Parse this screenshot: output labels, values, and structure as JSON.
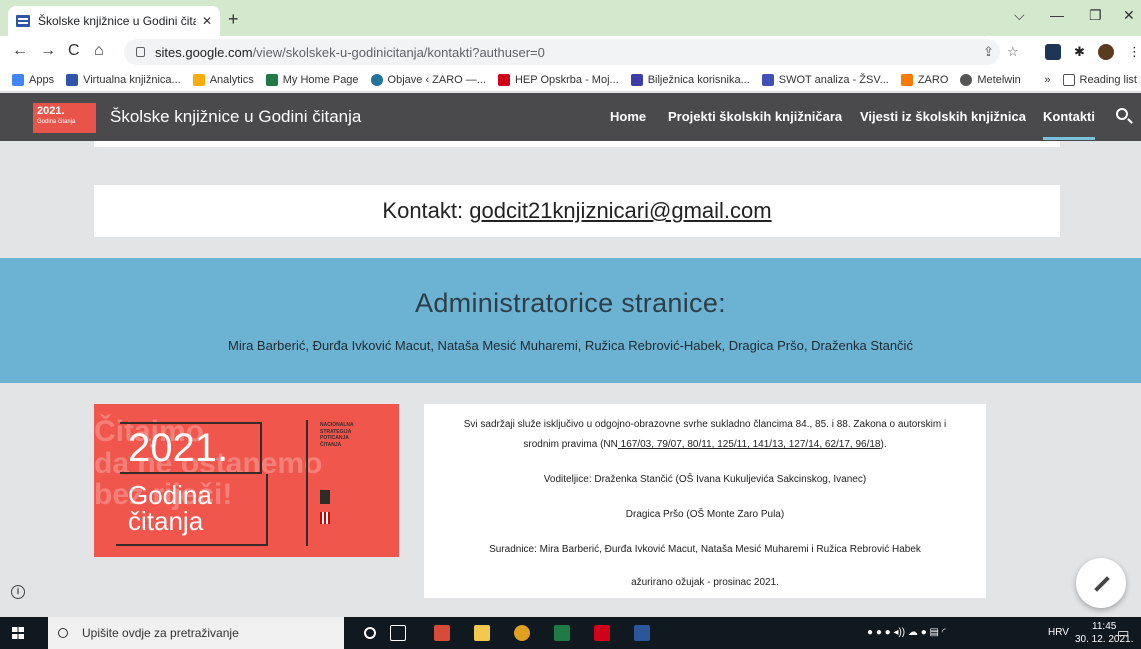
{
  "browser": {
    "tab_title": "Školske knjižnice u Godini čitanja",
    "url_host": "sites.google.com",
    "url_path": "/view/skolskek-u-godinicitanja/kontakti?authuser=0",
    "new_tab": "+",
    "tab_close": "✕"
  },
  "bookmarks": {
    "items": [
      "Apps",
      "Virtualna knjižnica...",
      "Analytics",
      "My Home Page",
      "Objave ‹ ZARO —...",
      "HEP Opskrba - Moj...",
      "Bilježnica korisnika...",
      "SWOT analiza - ŽSV...",
      "ZARO",
      "Metelwin"
    ],
    "overflow": "»",
    "reading_list": "Reading list"
  },
  "site": {
    "logo_year": "2021.",
    "logo_sub": "Godina čitanja",
    "title": "Školske knjižnice u Godini čitanja",
    "nav": [
      "Home",
      "Projekti školskih knjižničara",
      "Vijesti iz školskih knjižnica",
      "Kontakti"
    ],
    "active_nav": "Kontakti"
  },
  "contact": {
    "prefix": "Kontakt: ",
    "email": "godcit21knjiznicari@gmail.com"
  },
  "admins": {
    "heading": "Administratorice stranice:",
    "names": "Mira Barberić,  Đurđa Ivković Macut, Nataša Mesić Muharemi, Ružica Rebrović-Habek, Dragica Pršo, Draženka Stančić"
  },
  "banner": {
    "year": "2021.",
    "line1": "Godina",
    "line2": "čitanja",
    "ghost": "Čitajmo\nda ne ostanemo\nbez riječi!",
    "strategy": "NACIONALNA STRATEGIJA POTICANJA ČITANJA"
  },
  "info": {
    "line1": "Svi sadržaji služe isključivo u odgojno-obrazovne svrhe sukladno člancima 84., 85. i 88. Zakona o autorskim i",
    "line2_prefix": "srodnim pravima (NN",
    "line2_link": " 167/03, 79/07, 80/11, 125/11, 141/13, 127/14, 62/17, 96/18",
    "line2_suffix": ").",
    "leaders": "Voditeljice: Draženka Stančić (OŠ Ivana Kukuljevića Sakcinskog, Ivanec)",
    "leader2": "Dragica Pršo (OŠ Monte Zaro Pula)",
    "collaborators": "Suradnice:  Mira Barberić, Đurđa Ivković Macut, Nataša Mesić Muharemi i Ružica Rebrović Habek",
    "updated": "ažurirano ožujak - prosinac 2021."
  },
  "taskbar": {
    "search_placeholder": "Upišite ovdje za pretraživanje",
    "lang": "HRV",
    "time": "11:45",
    "date": "30. 12. 2021."
  },
  "colors": {
    "header": "#4a4a4c",
    "accent_blue": "#6cb3d3",
    "banner_red": "#f0564c"
  }
}
